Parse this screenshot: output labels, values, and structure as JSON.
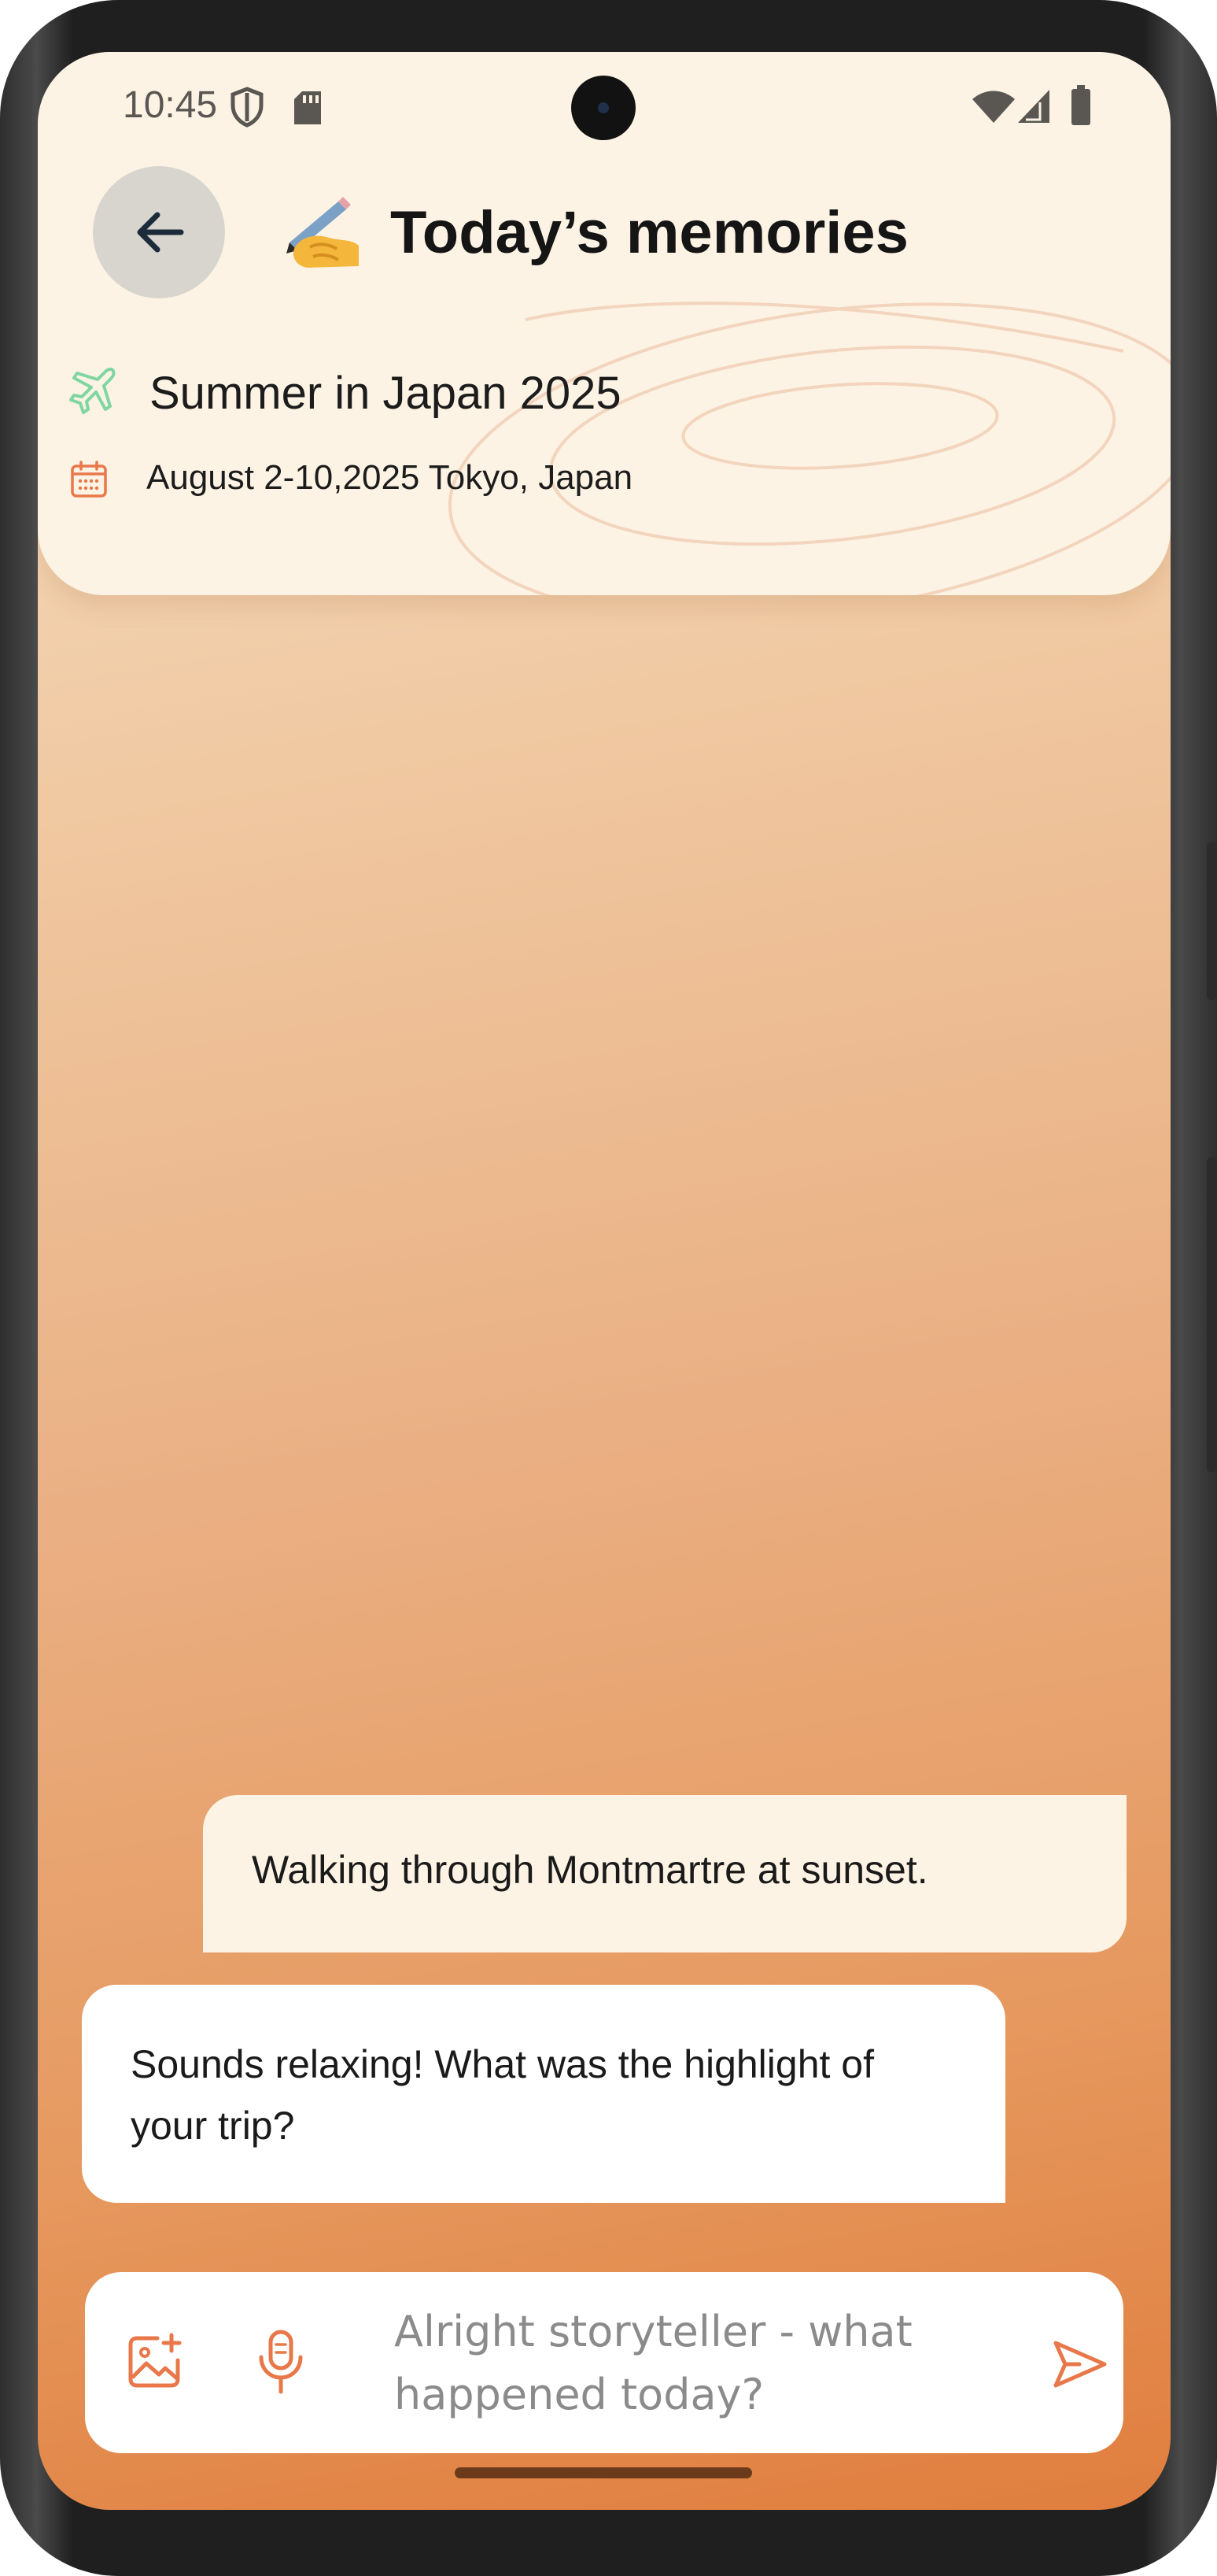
{
  "status_bar": {
    "time": "10:45",
    "icons": [
      "shield-icon",
      "sd-card-icon",
      "wifi-icon",
      "signal-icon",
      "battery-icon"
    ]
  },
  "header": {
    "back_icon": "arrow-left-icon",
    "title_emoji": "writing-hand-emoji",
    "title": "Today’s memories",
    "trip_icon": "airplane-icon",
    "trip_name": "Summer in Japan 2025",
    "date_icon": "calendar-icon",
    "trip_date": "August 2-10,2025 Tokyo, Japan"
  },
  "messages": [
    {
      "role": "user",
      "text": "Walking through Montmartre at sunset."
    },
    {
      "role": "assistant",
      "text": "Sounds relaxing! What was the highlight of your trip?"
    }
  ],
  "composer": {
    "add_image_icon": "image-plus-icon",
    "mic_icon": "microphone-icon",
    "placeholder": "Alright storyteller - what happened today?",
    "value": "",
    "send_icon": "send-icon"
  },
  "colors": {
    "header_bg": "#fcf3e4",
    "accent_orange": "#e8784a",
    "trip_icon_green": "#7fd6a0",
    "gradient_top": "#f7e2cb",
    "gradient_bottom": "#e07e3e"
  }
}
